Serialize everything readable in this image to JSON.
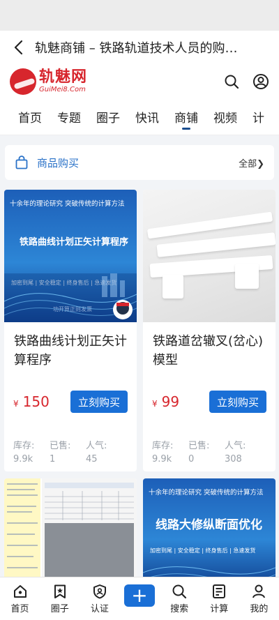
{
  "nav": {
    "title": "轨魅商铺 – 铁路轨道技术人员的购…"
  },
  "logo": {
    "cn": "轨魅网",
    "en": "GuiMei8.Com"
  },
  "tabs": [
    "首页",
    "专题",
    "圈子",
    "快讯",
    "商铺",
    "视频",
    "计"
  ],
  "active_tab_index": 4,
  "section": {
    "title": "商品购买",
    "all_label": "全部❯"
  },
  "products": [
    {
      "image": {
        "tagline": "十余年的理论研究  突破传统的计算方法",
        "big_text": "铁路曲线计划正矢计算程序",
        "features": "加密到尾 | 安全稳定 | 终身售后 | 急速发货",
        "brand": "功开算正则发票"
      },
      "name": "铁路曲线计划正矢计算程序",
      "currency": "¥",
      "price": "150",
      "buy_label": "立刻购买",
      "stats": [
        {
          "label": "库存:",
          "value": "9.9k"
        },
        {
          "label": "已售:",
          "value": "1"
        },
        {
          "label": "人气:",
          "value": "45"
        }
      ]
    },
    {
      "name": "铁路道岔辙叉(岔心)模型",
      "currency": "¥",
      "price": "99",
      "buy_label": "立刻购买",
      "stats": [
        {
          "label": "库存:",
          "value": "9.9k"
        },
        {
          "label": "已售:",
          "value": "0"
        },
        {
          "label": "人气:",
          "value": "308"
        }
      ]
    }
  ],
  "next_products": [
    {
      "image_text": ""
    },
    {
      "tagline": "十余年的理论研究  突破传统的计算方法",
      "big_text": "线路大修纵断面优化",
      "features": "加密到尾 | 安全稳定 | 终身售后 | 急速发货"
    }
  ],
  "bottom_nav": [
    {
      "label": "首页",
      "icon": "home-icon"
    },
    {
      "label": "圈子",
      "icon": "bookmark-star-icon"
    },
    {
      "label": "认证",
      "icon": "badge-check-icon"
    },
    {
      "label": "+",
      "icon": "plus-icon"
    },
    {
      "label": "搜索",
      "icon": "search-icon"
    },
    {
      "label": "计算",
      "icon": "calculator-icon"
    },
    {
      "label": "我的",
      "icon": "user-icon"
    }
  ],
  "colors": {
    "brand": "#d7262d",
    "accent": "#1a6fd6",
    "link": "#2a72c8"
  }
}
